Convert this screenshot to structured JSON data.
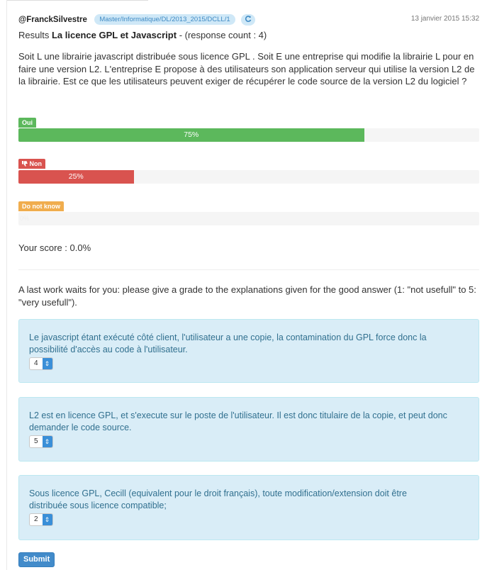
{
  "header": {
    "author": "@FranckSilvestre",
    "path": "Master/Informatique/DL/2013_2015/DCLL/1",
    "refresh_icon": "refresh-icon",
    "date": "13 janvier 2015 15:32"
  },
  "results": {
    "prefix": "Results",
    "title": "La licence GPL et Javascript",
    "suffix": "- (response count : 4)"
  },
  "question": "Soit L une librairie javascript distribuée sous licence GPL . Soit E une entreprise qui modifie la librairie L pour en faire une version L2. L'entreprise E propose à des utilisateurs son application serveur qui utilise la version L2 de la librairie. Est ce que les utilisateurs peuvent exiger de récupérer le code source de la version L2 du logiciel ?",
  "answers": [
    {
      "label": "Oui",
      "percent": 75,
      "percent_text": "75%",
      "color": "#5cb85c"
    },
    {
      "label": "Non",
      "percent": 25,
      "percent_text": "25%",
      "color": "#d9534f",
      "icon": "thumbs-down-icon"
    },
    {
      "label": "Do not know",
      "percent": 0,
      "percent_text": "0%",
      "color": "#f0ad4e"
    }
  ],
  "score": "Your score : 0.0%",
  "instruction": "A last work waits for you: please give a grade to the explanations given for the good answer (1: \"not usefull\" to 5: \"very usefull\").",
  "explanations": [
    {
      "text": "Le javascript étant exécuté côté client, l'utilisateur a une copie, la contamination du GPL force donc la possibilité d'accès au code à l'utilisateur.",
      "grade": "4"
    },
    {
      "text": "L2 est en licence GPL, et s'execute sur le poste de l'utilisateur. Il est donc titulaire de la copie, et peut donc demander le code source.",
      "grade": "5"
    },
    {
      "text": "Sous licence GPL, Cecill (equivalent pour le droit français), toute modification/extension doit être distribuée sous licence compatible;",
      "grade": "2"
    }
  ],
  "submit_label": "Submit"
}
